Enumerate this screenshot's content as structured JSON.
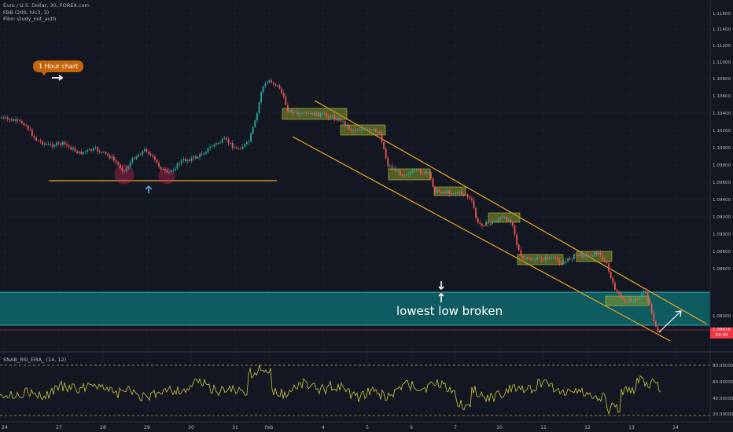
{
  "legend": {
    "symbol_line": "Euro / U.S. Dollar, 30, FOREX.com",
    "indicator_1": "FBB (200, hlc3, 3)",
    "indicator_2": "Fibo: study_not_auth",
    "rsi_label": "SNAB_RSI_EMA_ (14, 12)"
  },
  "annotations": {
    "callout": "1 Hour chart",
    "lowest_low": "lowest low broken"
  },
  "price_axis": [
    "1.11600",
    "1.11400",
    "1.11200",
    "1.11000",
    "1.10800",
    "1.10600",
    "1.10400",
    "1.10200",
    "1.10000",
    "1.09800",
    "1.09600",
    "1.09400",
    "1.09200",
    "1.09000",
    "1.08800",
    "1.08600",
    "1.08200"
  ],
  "rsi_axis": [
    "80.00000",
    "60.00000",
    "40.00000",
    "20.00000"
  ],
  "time_axis": [
    "24",
    "27",
    "28",
    "29",
    "30",
    "31",
    "Feb",
    "4",
    "5",
    "6",
    "7",
    "10",
    "11",
    "12",
    "13",
    "14"
  ],
  "last_price": {
    "price": "1.08416",
    "countdown": "23:30"
  },
  "colors": {
    "background": "#131722",
    "candle_up": "#26a69a",
    "candle_down": "#ef5350",
    "support": "#f5a623",
    "zone": "#0d7376",
    "box": "#7a8a26",
    "rsi": "#c8c83c"
  }
}
